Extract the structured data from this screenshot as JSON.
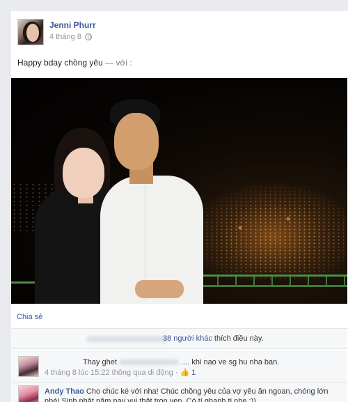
{
  "post": {
    "author": "Jenni Phurr",
    "date": "4 tháng 8",
    "privacy_icon": "globe-icon",
    "status_text": "Happy bday chồng yêu",
    "status_with": "— với :"
  },
  "actions": {
    "share_label": "Chia sẻ"
  },
  "likes": {
    "count_text": "38 người khác",
    "suffix": "thích điều này."
  },
  "comments": [
    {
      "name": "",
      "text_before": "Thay ghet",
      "text_after": ".... khi nao ve sg hu nha ban.",
      "time": "4 tháng 8 lúc 15:22 thông qua di động",
      "separator": "·",
      "like_count": "1"
    },
    {
      "name": "Andy Thao",
      "text": "Cho chúc ké với nha! Chúc chồng yêu của vợ yêu ăn ngoan, chóng lớn nhé! Sinh nhật năm nay vui thật trọn vẹn. Có tí ghanh tị nhẹ :))"
    }
  ],
  "colors": {
    "link": "#3b5998",
    "meta": "#90949c",
    "background": "#e9ebee"
  }
}
